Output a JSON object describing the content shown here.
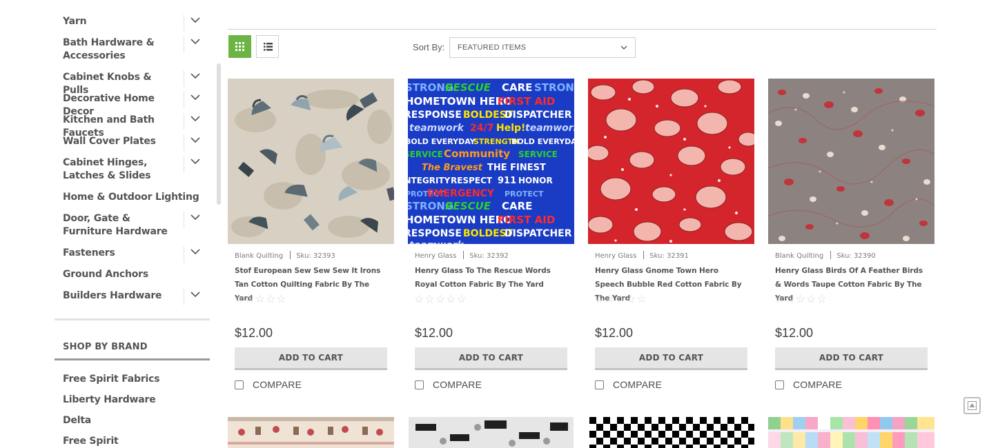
{
  "categories": [
    {
      "label": "Yarn",
      "expandable": true
    },
    {
      "label": "Bath Hardware & Accessories",
      "expandable": true
    },
    {
      "label": "Cabinet Knobs & Pulls",
      "expandable": true
    },
    {
      "label": "Decorative Home Decor",
      "expandable": true
    },
    {
      "label": "Kitchen and Bath Faucets",
      "expandable": true
    },
    {
      "label": "Wall Cover Plates",
      "expandable": true
    },
    {
      "label": "Cabinet Hinges, Latches & Slides",
      "expandable": true
    },
    {
      "label": "Home & Outdoor Lighting",
      "expandable": false
    },
    {
      "label": "Door, Gate & Furniture Hardware",
      "expandable": true
    },
    {
      "label": "Fasteners",
      "expandable": true
    },
    {
      "label": "Ground Anchors",
      "expandable": false
    },
    {
      "label": "Builders Hardware",
      "expandable": true
    }
  ],
  "brands": {
    "heading": "SHOP BY BRAND",
    "items": [
      "Free Spirit Fabrics",
      "Liberty Hardware",
      "Delta",
      "Free Spirit"
    ]
  },
  "toolbar": {
    "sort_label": "Sort By:",
    "sort_value": "FEATURED ITEMS",
    "grid_icon": "grid-view-icon",
    "list_icon": "list-view-icon",
    "accent_color": "#6cb443"
  },
  "products": [
    {
      "brand": "Blank Quilting",
      "sku": "Sku: 32393",
      "title": "Stof European Sew Sew Sew It Irons Tan Cotton Quilting Fabric By The Yard",
      "stars": "☆☆☆☆☆",
      "price": "$12.00",
      "cart_label": "ADD TO CART",
      "compare_label": "COMPARE"
    },
    {
      "brand": "Henry Glass",
      "sku": "Sku: 32392",
      "title": "Henry Glass To The Rescue Words Royal Cotton Fabric By The Yard",
      "stars": "☆☆☆☆☆",
      "price": "$12.00",
      "cart_label": "ADD TO CART",
      "compare_label": "COMPARE"
    },
    {
      "brand": "Henry Glass",
      "sku": "Sku: 32391",
      "title": "Henry Glass Gnome Town Hero Speech Bubble Red Cotton Fabric By The Yard",
      "stars": "☆☆☆☆☆",
      "price": "$12.00",
      "cart_label": "ADD TO CART",
      "compare_label": "COMPARE"
    },
    {
      "brand": "Blank Quilting",
      "sku": "Sku: 32390",
      "title": "Henry Glass Birds Of A Feather Birds & Words Taupe Cotton Fabric By The Yard",
      "stars": "☆☆☆☆☆",
      "price": "$12.00",
      "cart_label": "ADD TO CART",
      "compare_label": "COMPARE"
    }
  ],
  "rescue_fabric_words": [
    "STRONG",
    "RESCUE",
    "CARE",
    "HOMETOWN HERO",
    "FIRST AID",
    "RESPONSE",
    "BOLDEST",
    "DISPATCHER",
    "teamwork",
    "24/7",
    "Help!",
    "BOLD EVERYDAY",
    "STRENGTH",
    "SERVICE",
    "Community",
    "The Bravest",
    "THE FINEST",
    "INTEGRITY",
    "RESPECT",
    "911",
    "HONOR",
    "EMERGENCY",
    "PROTECT"
  ],
  "scroll_top_icon": "scroll-to-top-icon"
}
